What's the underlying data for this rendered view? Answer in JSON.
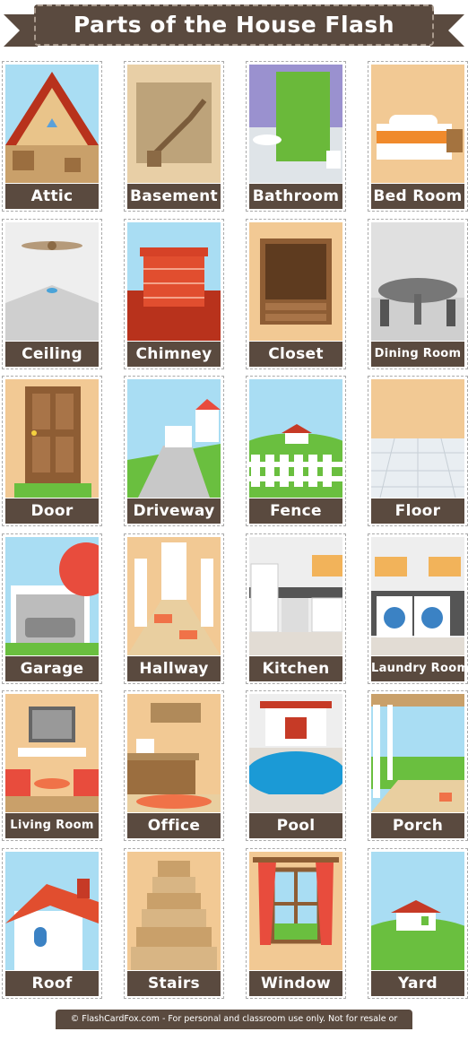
{
  "title": "Parts of the House Flash Cards",
  "cards": [
    {
      "label": "Attic",
      "icon": "attic-picture"
    },
    {
      "label": "Basement",
      "icon": "basement-picture"
    },
    {
      "label": "Bathroom",
      "icon": "bathroom-picture"
    },
    {
      "label": "Bed Room",
      "icon": "bedroom-picture"
    },
    {
      "label": "Ceiling",
      "icon": "ceiling-picture"
    },
    {
      "label": "Chimney",
      "icon": "chimney-picture"
    },
    {
      "label": "Closet",
      "icon": "closet-picture"
    },
    {
      "label": "Dining Room",
      "icon": "dining-room-picture"
    },
    {
      "label": "Door",
      "icon": "door-picture"
    },
    {
      "label": "Driveway",
      "icon": "driveway-picture"
    },
    {
      "label": "Fence",
      "icon": "fence-picture"
    },
    {
      "label": "Floor",
      "icon": "floor-picture"
    },
    {
      "label": "Garage",
      "icon": "garage-picture"
    },
    {
      "label": "Hallway",
      "icon": "hallway-picture"
    },
    {
      "label": "Kitchen",
      "icon": "kitchen-picture"
    },
    {
      "label": "Laundry Room",
      "icon": "laundry-room-picture"
    },
    {
      "label": "Living Room",
      "icon": "living-room-picture"
    },
    {
      "label": "Office",
      "icon": "office-picture"
    },
    {
      "label": "Pool",
      "icon": "pool-picture"
    },
    {
      "label": "Porch",
      "icon": "porch-picture"
    },
    {
      "label": "Roof",
      "icon": "roof-picture"
    },
    {
      "label": "Stairs",
      "icon": "stairs-picture"
    },
    {
      "label": "Window",
      "icon": "window-picture"
    },
    {
      "label": "Yard",
      "icon": "yard-picture"
    }
  ],
  "footer": "© FlashCardFox.com - For personal and classroom use only. Not for resale or distribution.",
  "colors": {
    "label_bg": "#5a4a3f",
    "accent_red": "#e84c3d",
    "sky": "#a9ddf3",
    "grass": "#6abf3f",
    "tan": "#f2c994"
  }
}
